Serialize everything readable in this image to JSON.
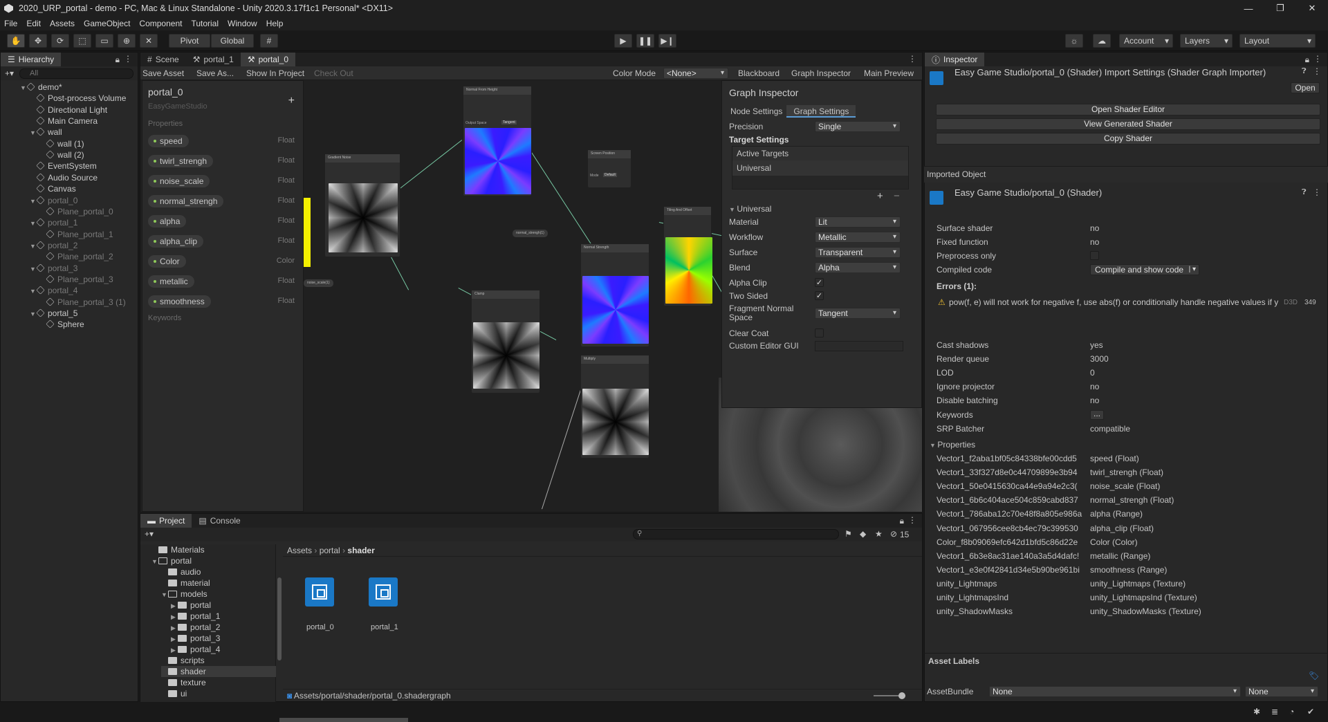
{
  "window": {
    "title": "2020_URP_portal - demo - PC, Mac & Linux Standalone - Unity 2020.3.17f1c1 Personal* <DX11>",
    "minimize": "—",
    "maximize": "❐",
    "close": "✕"
  },
  "menu": [
    "File",
    "Edit",
    "Assets",
    "GameObject",
    "Component",
    "Tutorial",
    "Window",
    "Help"
  ],
  "toolbar": {
    "pivot": "Pivot",
    "global": "Global",
    "account": "Account",
    "layers": "Layers",
    "layout": "Layout"
  },
  "hierarchy": {
    "tab": "Hierarchy",
    "search_placeholder": "All",
    "items": [
      {
        "label": "demo*",
        "depth": 0,
        "dim": false
      },
      {
        "label": "Post-process Volume",
        "depth": 1,
        "dim": false
      },
      {
        "label": "Directional Light",
        "depth": 1,
        "dim": false
      },
      {
        "label": "Main Camera",
        "depth": 1,
        "dim": false
      },
      {
        "label": "wall",
        "depth": 1,
        "dim": false
      },
      {
        "label": "wall (1)",
        "depth": 2,
        "dim": false
      },
      {
        "label": "wall (2)",
        "depth": 2,
        "dim": false
      },
      {
        "label": "EventSystem",
        "depth": 1,
        "dim": false
      },
      {
        "label": "Audio Source",
        "depth": 1,
        "dim": false
      },
      {
        "label": "Canvas",
        "depth": 1,
        "dim": false
      },
      {
        "label": "portal_0",
        "depth": 1,
        "dim": true
      },
      {
        "label": "Plane_portal_0",
        "depth": 2,
        "dim": true
      },
      {
        "label": "portal_1",
        "depth": 1,
        "dim": true
      },
      {
        "label": "Plane_portal_1",
        "depth": 2,
        "dim": true
      },
      {
        "label": "portal_2",
        "depth": 1,
        "dim": true
      },
      {
        "label": "Plane_portal_2",
        "depth": 2,
        "dim": true
      },
      {
        "label": "portal_3",
        "depth": 1,
        "dim": true
      },
      {
        "label": "Plane_portal_3",
        "depth": 2,
        "dim": true
      },
      {
        "label": "portal_4",
        "depth": 1,
        "dim": true
      },
      {
        "label": "Plane_portal_3 (1)",
        "depth": 2,
        "dim": true
      },
      {
        "label": "portal_5",
        "depth": 1,
        "dim": false
      },
      {
        "label": "Sphere",
        "depth": 2,
        "dim": false
      }
    ]
  },
  "center_tabs": [
    "Scene",
    "portal_1",
    "portal_0"
  ],
  "graph_toolbar": {
    "save_asset": "Save Asset",
    "save_as": "Save As...",
    "show_in_project": "Show In Project",
    "check_out": "Check Out",
    "color_mode_label": "Color Mode",
    "color_mode_value": "<None>",
    "blackboard": "Blackboard",
    "graph_inspector": "Graph Inspector",
    "main_preview": "Main Preview"
  },
  "blackboard": {
    "title": "portal_0",
    "subtitle": "EasyGameStudio",
    "add": "+",
    "properties_label": "Properties",
    "keywords_label": "Keywords",
    "properties": [
      {
        "name": "speed",
        "type": "Float"
      },
      {
        "name": "twirl_strengh",
        "type": "Float"
      },
      {
        "name": "noise_scale",
        "type": "Float"
      },
      {
        "name": "normal_strengh",
        "type": "Float"
      },
      {
        "name": "alpha",
        "type": "Float"
      },
      {
        "name": "alpha_clip",
        "type": "Float"
      },
      {
        "name": "Color",
        "type": "Color"
      },
      {
        "name": "metallic",
        "type": "Float"
      },
      {
        "name": "smoothness",
        "type": "Float"
      }
    ]
  },
  "nodes": {
    "gradient_noise": "Gradient Noise",
    "normal_from_height": "Normal From Height",
    "output_space": "Output Space",
    "tangent": "Tangent",
    "screen_position": "Screen Position",
    "mode": "Mode",
    "default": "Default",
    "tiling_offset": "Tiling And Offset",
    "normal_strength": "Normal Strength",
    "clamp": "Clamp",
    "multiply": "Multiply",
    "normal_strengh_prop": "normal_strengh(1)",
    "noise_scale_prop": "noise_scale(1)"
  },
  "graph_inspector": {
    "title": "Graph Inspector",
    "tabs": [
      "Node Settings",
      "Graph Settings"
    ],
    "precision_label": "Precision",
    "precision_value": "Single",
    "target_settings": "Target Settings",
    "active_targets": "Active Targets",
    "universal_item": "Universal",
    "plus": "+",
    "minus": "−",
    "universal_section": "Universal",
    "rows": [
      {
        "label": "Material",
        "value": "Lit",
        "kind": "dropdown"
      },
      {
        "label": "Workflow",
        "value": "Metallic",
        "kind": "dropdown"
      },
      {
        "label": "Surface",
        "value": "Transparent",
        "kind": "dropdown"
      },
      {
        "label": "Blend",
        "value": "Alpha",
        "kind": "dropdown"
      },
      {
        "label": "Alpha Clip",
        "value": "✓",
        "kind": "check"
      },
      {
        "label": "Two Sided",
        "value": "✓",
        "kind": "check"
      },
      {
        "label": "Fragment Normal Space",
        "value": "Tangent",
        "kind": "dropdown"
      },
      {
        "label": "Clear Coat",
        "value": "",
        "kind": "check"
      },
      {
        "label": "Custom Editor GUI",
        "value": "",
        "kind": "field"
      }
    ]
  },
  "inspector": {
    "tab": "Inspector",
    "header": "Easy Game Studio/portal_0 (Shader) Import Settings (Shader Graph Importer)",
    "open": "Open",
    "buttons": [
      "Open Shader Editor",
      "View Generated Shader",
      "Copy Shader"
    ],
    "imported_object": "Imported Object",
    "shader_header": "Easy Game Studio/portal_0 (Shader)",
    "kv_top": [
      {
        "k": "Surface shader",
        "v": "no"
      },
      {
        "k": "Fixed function",
        "v": "no"
      },
      {
        "k": "Preprocess only",
        "v": ""
      },
      {
        "k": "Compiled code",
        "v": "Compile and show code"
      }
    ],
    "errors_label": "Errors (1):",
    "error_text": "pow(f, e) will not work for negative f, use abs(f) or conditionally handle negative values if you expect them",
    "error_platform": "D3D",
    "error_line": "349",
    "kv_mid": [
      {
        "k": "Cast shadows",
        "v": "yes"
      },
      {
        "k": "Render queue",
        "v": "3000"
      },
      {
        "k": "LOD",
        "v": "0"
      },
      {
        "k": "Ignore projector",
        "v": "no"
      },
      {
        "k": "Disable batching",
        "v": "no"
      },
      {
        "k": "Keywords",
        "v": "..."
      },
      {
        "k": "SRP Batcher",
        "v": "compatible"
      }
    ],
    "properties_label": "Properties",
    "props": [
      {
        "k": "Vector1_f2aba1bf05c84338bfe00cdd5",
        "v": "speed (Float)"
      },
      {
        "k": "Vector1_33f327d8e0c44709899e3b94",
        "v": "twirl_strengh (Float)"
      },
      {
        "k": "Vector1_50e0415630ca44e9a94e2c3(",
        "v": "noise_scale (Float)"
      },
      {
        "k": "Vector1_6b6c404ace504c859cabd837",
        "v": "normal_strengh (Float)"
      },
      {
        "k": "Vector1_786aba12c70e48f8a805e986a",
        "v": "alpha (Range)"
      },
      {
        "k": "Vector1_067956cee8cb4ec79c399530",
        "v": "alpha_clip (Float)"
      },
      {
        "k": "Color_f8b09069efc642d1bfd5c86d22e",
        "v": "Color (Color)"
      },
      {
        "k": "Vector1_6b3e8ac31ae140a3a5d4dafc!",
        "v": "metallic (Range)"
      },
      {
        "k": "Vector1_e3e0f42841d34e5b90be961bi",
        "v": "smoothness (Range)"
      },
      {
        "k": "unity_Lightmaps",
        "v": "unity_Lightmaps (Texture)"
      },
      {
        "k": "unity_LightmapsInd",
        "v": "unity_LightmapsInd (Texture)"
      },
      {
        "k": "unity_ShadowMasks",
        "v": "unity_ShadowMasks (Texture)"
      }
    ],
    "asset_labels": "Asset Labels",
    "assetbundle_label": "AssetBundle",
    "assetbundle_value": "None",
    "assetbundle_variant": "None"
  },
  "project": {
    "tabs": [
      "Project",
      "Console"
    ],
    "breadcrumb": [
      "Assets",
      "portal",
      "shader"
    ],
    "count": "15",
    "tree": [
      {
        "label": "Materials",
        "depth": 0,
        "arrow": ""
      },
      {
        "label": "portal",
        "depth": 0,
        "arrow": "▼"
      },
      {
        "label": "audio",
        "depth": 1,
        "arrow": ""
      },
      {
        "label": "material",
        "depth": 1,
        "arrow": ""
      },
      {
        "label": "models",
        "depth": 1,
        "arrow": "▼"
      },
      {
        "label": "portal",
        "depth": 2,
        "arrow": "▶"
      },
      {
        "label": "portal_1",
        "depth": 2,
        "arrow": "▶"
      },
      {
        "label": "portal_2",
        "depth": 2,
        "arrow": "▶"
      },
      {
        "label": "portal_3",
        "depth": 2,
        "arrow": "▶"
      },
      {
        "label": "portal_4",
        "depth": 2,
        "arrow": "▶"
      },
      {
        "label": "scripts",
        "depth": 1,
        "arrow": ""
      },
      {
        "label": "shader",
        "depth": 1,
        "arrow": ""
      },
      {
        "label": "texture",
        "depth": 1,
        "arrow": ""
      },
      {
        "label": "ui",
        "depth": 1,
        "arrow": ""
      }
    ],
    "assets": [
      "portal_0",
      "portal_1"
    ],
    "path": "Assets/portal/shader/portal_0.shadergraph"
  }
}
